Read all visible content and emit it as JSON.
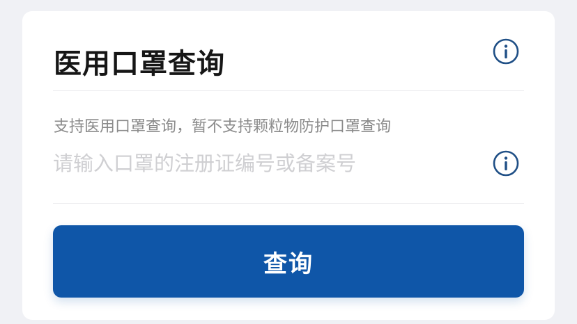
{
  "card": {
    "title": "医用口罩查询",
    "hint": "支持医用口罩查询，暂不支持颗粒物防护口罩查询",
    "input": {
      "value": "",
      "placeholder": "请输入口罩的注册证编号或备案号"
    },
    "button": {
      "label": "查询"
    }
  },
  "icons": {
    "title_info": "info-icon",
    "input_info": "info-icon"
  },
  "colors": {
    "accent": "#0f56a8",
    "icon": "#1f4f86",
    "background": "#f0f1f5",
    "card": "#ffffff"
  }
}
